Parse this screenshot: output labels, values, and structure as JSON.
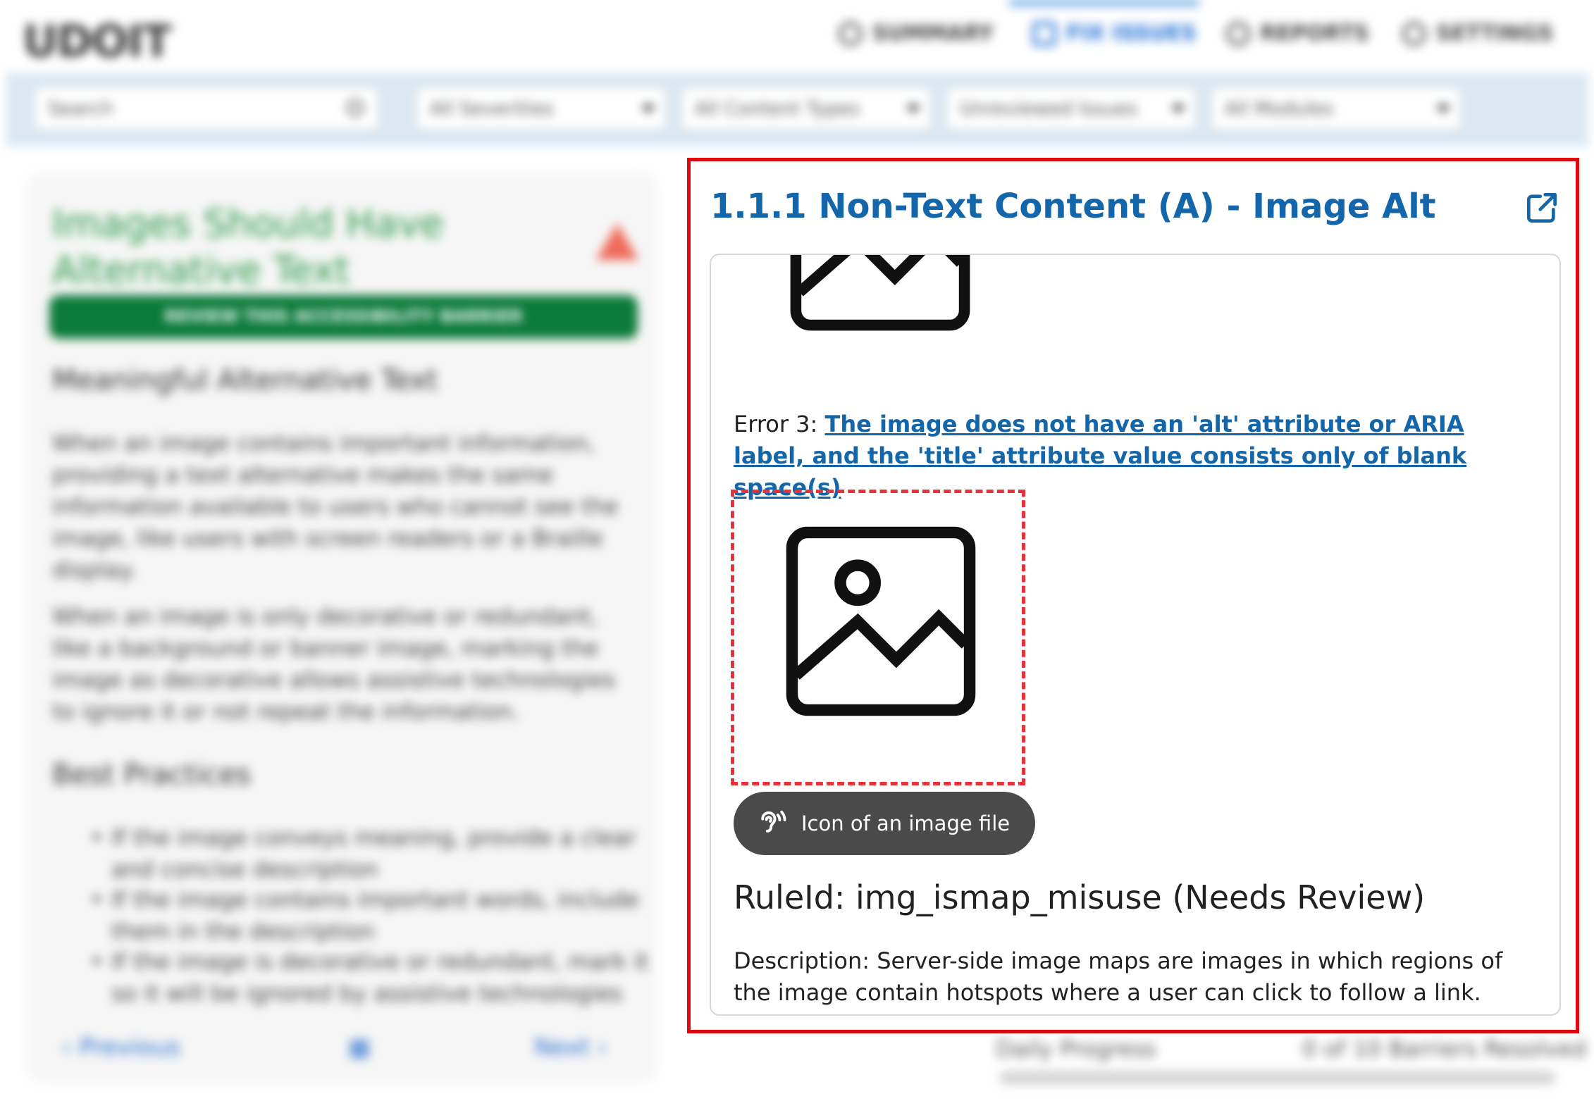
{
  "app": {
    "logo": "UDOIT",
    "nav": [
      {
        "label": "Summary",
        "icon": "home-icon"
      },
      {
        "label": "Fix Issues",
        "icon": "search-icon"
      },
      {
        "label": "Reports",
        "icon": "chart-icon"
      },
      {
        "label": "Settings",
        "icon": "gear-icon"
      }
    ]
  },
  "filters": {
    "search_placeholder": "Search",
    "severity": "All Severities",
    "content_type": "All Content Types",
    "status": "Unreviewed Issues",
    "modules": "All Modules"
  },
  "issue_card": {
    "title": "Images Should Have Alternative Text",
    "action_button": "Review this accessibility barrier",
    "heading": "Meaningful Alternative Text",
    "para1": "When an image contains important information, providing a text alternative makes the same information available to users who cannot see the image, like users with screen readers or a Braille display.",
    "para2": "When an image is only decorative or redundant, like a background or banner image, marking the image as decorative allows assistive technologies to ignore it or not repeat the information.",
    "best_practices_heading": "Best Practices",
    "best_practices": [
      "If the image conveys meaning, provide a clear and concise description",
      "If the image contains important words, include them in the description",
      "If the image is decorative or redundant, mark it so it will be ignored by assistive technologies"
    ],
    "prev_label": "Previous",
    "next_label": "Next"
  },
  "progress": {
    "label": "Daily Progress",
    "count": "0 of 10 Barriers Resolved"
  },
  "panel": {
    "title": "1.1.1 Non-Text Content (A) - Image Alt",
    "error_prefix": "Error 3:",
    "error_link": "The image does not have an 'alt' attribute or ARIA label, and the 'title' attribute value consists only of blank space(s)",
    "alt_text": "Icon of an image file",
    "rule_heading": "RuleId: img_ismap_misuse (Needs Review)",
    "description": "Description: Server-side image maps are images in which regions of the image contain hotspots where a user can click to follow a link. Because the"
  },
  "colors": {
    "accent": "#1366aa",
    "highlight_border": "#e2060f",
    "dashed_border": "#e8323a",
    "pill_bg": "#4a4a4a"
  }
}
